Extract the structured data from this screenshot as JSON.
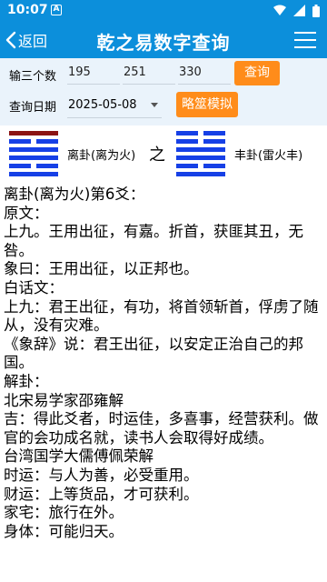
{
  "status": {
    "time": "10:07",
    "notif_letter": "A"
  },
  "header": {
    "back_label": "返回",
    "title": "乾之易数字查询"
  },
  "form": {
    "numbers_label": "输三个数",
    "num1": "195",
    "num2": "251",
    "num3": "330",
    "query_button": "查询",
    "date_label": "查询日期",
    "date_value": "2025-05-08",
    "sim_button": "略筮模拟"
  },
  "hexagrams": {
    "left_name": "离卦(离为火)",
    "connector": "之",
    "right_name": "丰卦(雷火丰)",
    "left_lines_top_to_bottom": [
      true,
      false,
      true,
      true,
      false,
      true
    ],
    "right_lines_top_to_bottom": [
      false,
      false,
      true,
      true,
      false,
      true
    ],
    "colors": {
      "red": "#8b1414",
      "blue": "#1640e6",
      "moving_line_color": "red"
    }
  },
  "content": {
    "lines": [
      "离卦(离为火)第6爻：",
      "原文：",
      "上九。王用出征，有嘉。折首，获匪其丑，无咎。",
      "象曰：王用出征，以正邦也。",
      "白话文：",
      "上九：君王出征，有功，将首领斩首，俘虏了随从，没有灾难。",
      "《象辞》说：君王出征，以安定正治自己的邦国。",
      "解卦：",
      "北宋易学家邵雍解",
      "吉：得此爻者，时运佳，多喜事，经营获利。做官的会功成名就，读书人会取得好成绩。",
      "台湾国学大儒傅佩荣解",
      "时运：与人为善，必受重用。",
      "财运：上等货品，才可获利。",
      "家宅：旅行在外。",
      "身体：可能归天。"
    ]
  }
}
